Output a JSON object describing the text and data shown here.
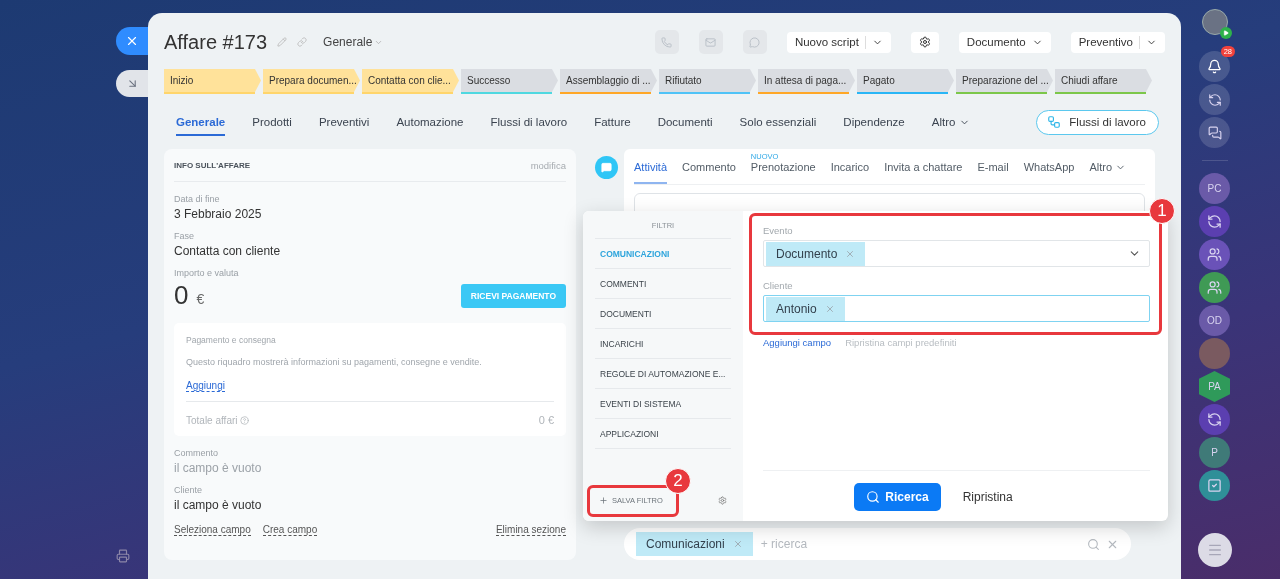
{
  "window": {
    "title": "Affare #173",
    "category": "Generale"
  },
  "header_buttons": {
    "script": "Nuovo script",
    "document": "Documento",
    "estimate": "Preventivo"
  },
  "stages": [
    {
      "label": "Inizio",
      "passed": true,
      "color": "#ffd56b"
    },
    {
      "label": "Prepara documen...",
      "passed": true,
      "color": "#ffd56b"
    },
    {
      "label": "Contatta con clie...",
      "passed": true,
      "color": "#ffd56b"
    },
    {
      "label": "Successo",
      "passed": false,
      "color": "#4fd8e0"
    },
    {
      "label": "Assemblaggio di ...",
      "passed": false,
      "color": "#ffa726"
    },
    {
      "label": "Rifiutato",
      "passed": false,
      "color": "#4fc3f7"
    },
    {
      "label": "In attesa di paga...",
      "passed": false,
      "color": "#ffa726"
    },
    {
      "label": "Pagato",
      "passed": false,
      "color": "#29b6f6"
    },
    {
      "label": "Preparazione del ...",
      "passed": false,
      "color": "#7cc74a"
    },
    {
      "label": "Chiudi affare",
      "passed": false,
      "color": "#7cc74a"
    }
  ],
  "tabs": [
    {
      "label": "Generale",
      "selected": true,
      "kind": "plain"
    },
    {
      "label": "Prodotti",
      "selected": false,
      "kind": "plain"
    },
    {
      "label": "Preventivi",
      "selected": false,
      "kind": "plain"
    },
    {
      "label": "Automazione",
      "selected": false,
      "kind": "plain"
    },
    {
      "label": "Flussi di lavoro",
      "selected": false,
      "kind": "plain"
    },
    {
      "label": "Fatture",
      "selected": false,
      "kind": "plain"
    },
    {
      "label": "Documenti",
      "selected": false,
      "kind": "plain"
    },
    {
      "label": "Solo essenziali",
      "selected": false,
      "kind": "plain"
    },
    {
      "label": "Dipendenze",
      "selected": false,
      "kind": "plain"
    },
    {
      "label": "Altro",
      "selected": false,
      "kind": "menu"
    }
  ],
  "workflow_button": "Flussi di lavoro",
  "info_card": {
    "title": "INFO SULL'AFFARE",
    "edit": "modifica",
    "fields": [
      {
        "label": "Data di fine",
        "value": "3 Febbraio 2025"
      },
      {
        "label": "Fase",
        "value": "Contatta con cliente"
      }
    ],
    "amount": {
      "label": "Importo e valuta",
      "value": "0",
      "currency": "€",
      "button": "RICEVI PAGAMENTO"
    },
    "payment": {
      "title": "Pagamento e consegna",
      "text": "Questo riquadro mostrerà informazioni su pagamenti, consegne e vendite.",
      "link": "Aggiungi",
      "total_label": "Totale affari",
      "total": "0 €"
    },
    "extra_fields": [
      {
        "label": "Commento",
        "value": "il campo è vuoto",
        "muted": true
      },
      {
        "label": "Cliente",
        "value": "il campo è vuoto",
        "muted": false
      }
    ],
    "links": [
      "Seleziona campo",
      "Crea campo"
    ],
    "delete": "Elimina sezione"
  },
  "activity_tabs": [
    {
      "label": "Attività",
      "selected": true,
      "kind": "plain"
    },
    {
      "label": "Commento",
      "selected": false,
      "kind": "plain"
    },
    {
      "label": "Prenotazione",
      "selected": false,
      "kind": "new",
      "badge": "NUOVO"
    },
    {
      "label": "Incarico",
      "selected": false,
      "kind": "plain"
    },
    {
      "label": "Invita a chattare",
      "selected": false,
      "kind": "plain"
    },
    {
      "label": "E-mail",
      "selected": false,
      "kind": "plain"
    },
    {
      "label": "WhatsApp",
      "selected": false,
      "kind": "plain"
    },
    {
      "label": "Altro",
      "selected": false,
      "kind": "menu"
    }
  ],
  "filter": {
    "heading": "FILTRI",
    "items": [
      {
        "label": "COMUNICAZIONI",
        "selected": true
      },
      {
        "label": "COMMENTI",
        "selected": false
      },
      {
        "label": "DOCUMENTI",
        "selected": false
      },
      {
        "label": "INCARICHI",
        "selected": false
      },
      {
        "label": "REGOLE DI AUTOMAZIONE E...",
        "selected": false
      },
      {
        "label": "EVENTI DI SISTEMA",
        "selected": false
      },
      {
        "label": "APPLICAZIONI",
        "selected": false
      }
    ],
    "save": "SALVA FILTRO",
    "fields": [
      {
        "label": "Evento",
        "tag": "Documento",
        "kind": "dropdown",
        "focused": false
      },
      {
        "label": "Cliente",
        "tag": "Antonio",
        "kind": "text",
        "focused": true
      }
    ],
    "add_field": "Aggiungi campo",
    "restore_fields": "Ripristina campi predefiniti",
    "search": "Ricerca",
    "reset": "Ripristina"
  },
  "search_bar": {
    "tag": "Comunicazioni",
    "placeholder": "+ ricerca"
  },
  "annotations": [
    {
      "number": "1"
    },
    {
      "number": "2"
    }
  ],
  "rail": {
    "notifications": "28",
    "items": [
      {
        "kind": "initials",
        "text": "PC",
        "color": "#6a5aa8"
      },
      {
        "kind": "sync",
        "color": "#5b3fb0"
      },
      {
        "kind": "group",
        "color": "#6a52b8"
      },
      {
        "kind": "group",
        "color": "#3f9a55"
      },
      {
        "kind": "initials",
        "text": "OD",
        "color": "#6a5aa8"
      },
      {
        "kind": "photo",
        "color": "#7a5a60"
      },
      {
        "kind": "hex",
        "text": "PA",
        "color": "#2f9a5a"
      },
      {
        "kind": "sync",
        "color": "#5b3fb0"
      },
      {
        "kind": "initials",
        "text": "P",
        "color": "#3f7a78"
      },
      {
        "kind": "task",
        "color": "#2f8f98"
      }
    ]
  }
}
